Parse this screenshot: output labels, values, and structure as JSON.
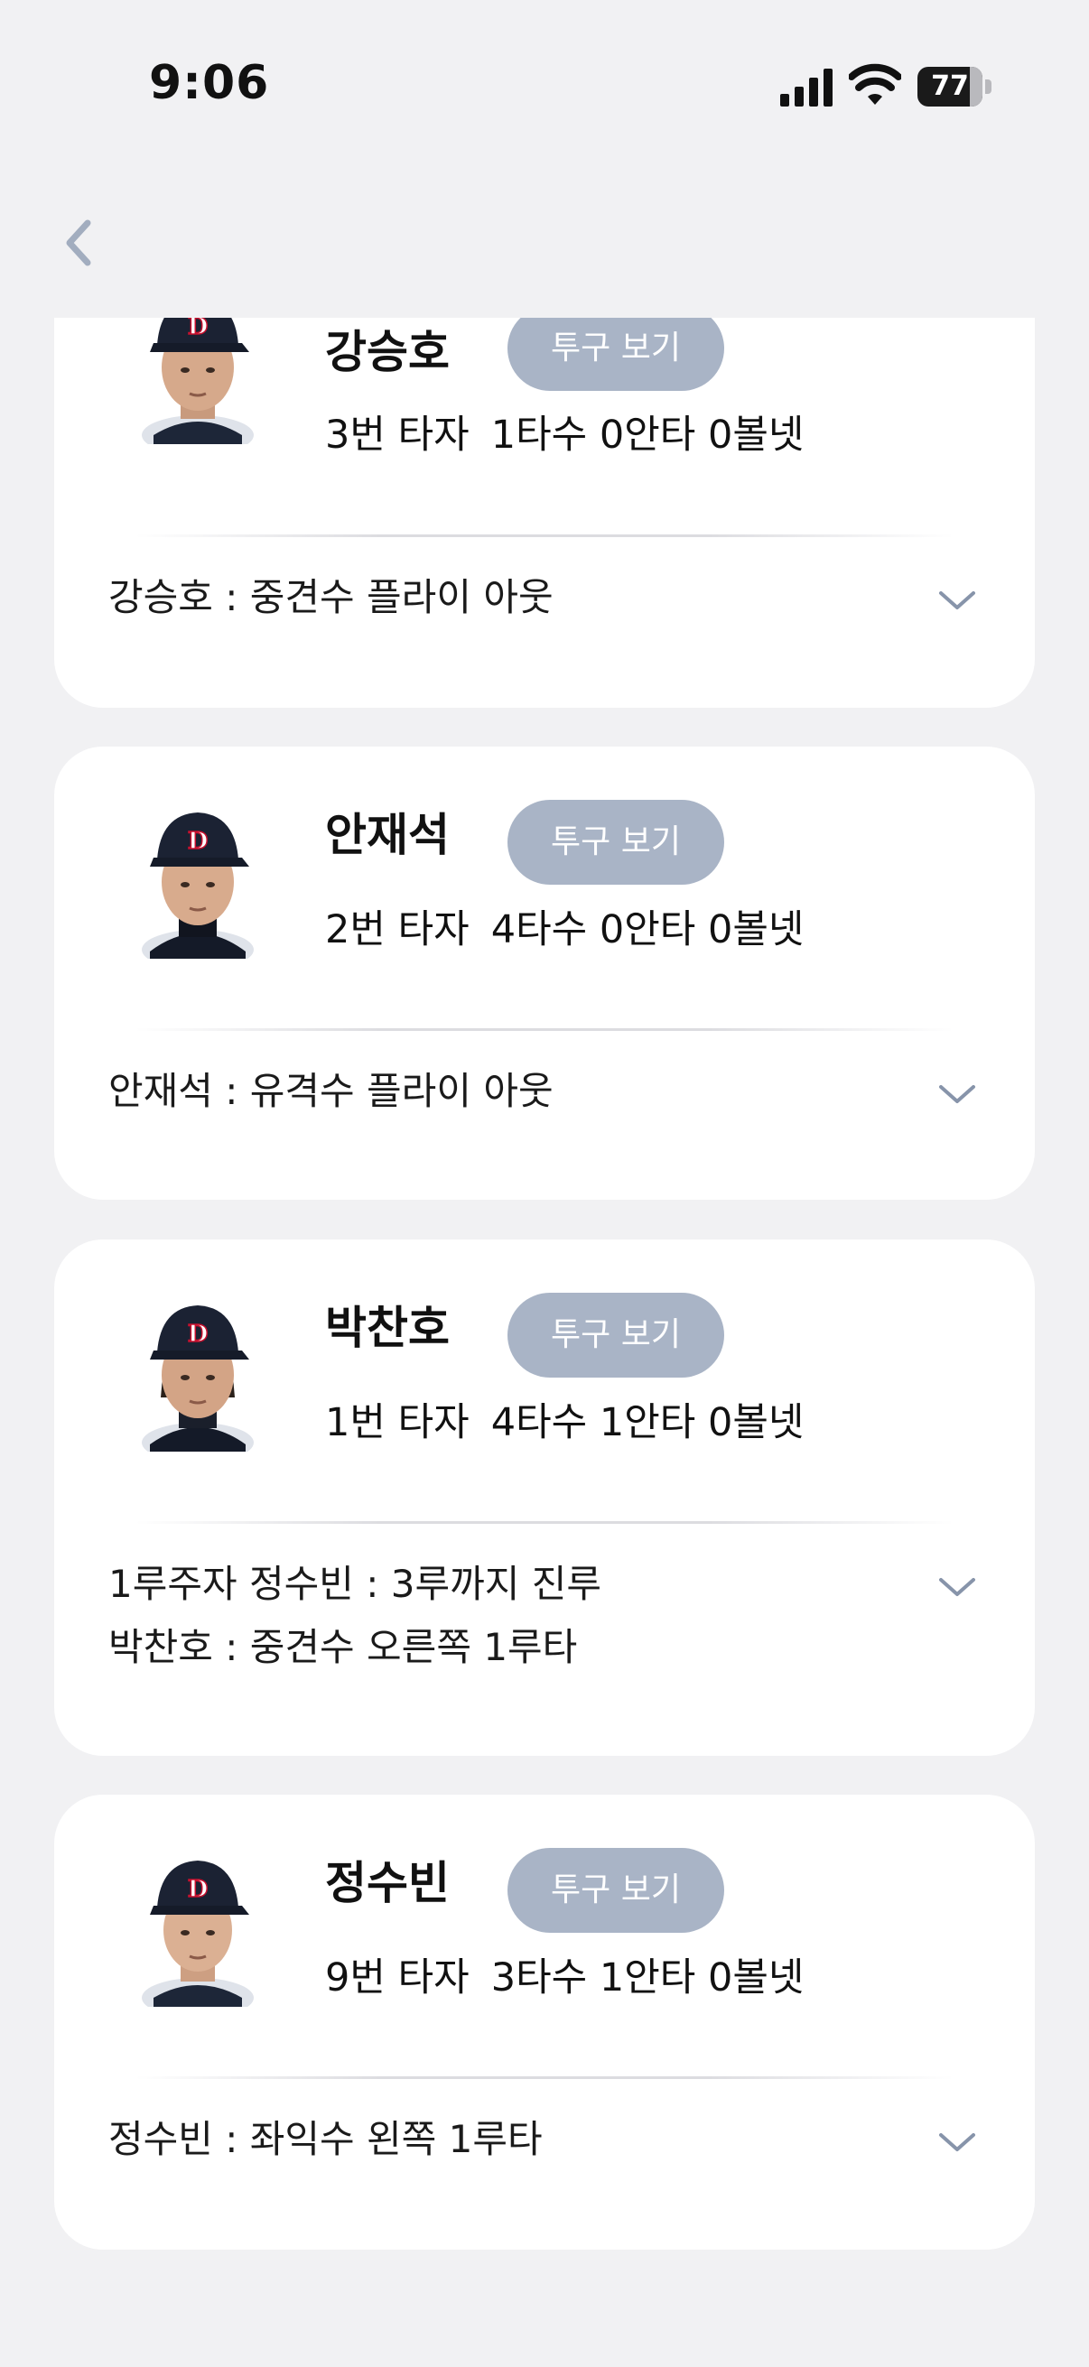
{
  "status_bar": {
    "time": "9:06",
    "battery_level": "77",
    "icons": [
      "signal-icon",
      "wifi-icon",
      "battery-icon"
    ]
  },
  "nav": {
    "back_icon": "chevron-left-icon"
  },
  "colors": {
    "background": "#f1f1f3",
    "card": "#ffffff",
    "pitch_button": "#a9b4c6",
    "back_chevron": "#a2adbf",
    "expand_chevron": "#8794aa"
  },
  "at_bats": [
    {
      "name": "강승호",
      "button_label": "투구 보기",
      "order": "3번 타자",
      "stats": "1타수 0안타 0볼넷",
      "results": [
        "강승호 : 중견수 플라이 아웃"
      ]
    },
    {
      "name": "안재석",
      "button_label": "투구 보기",
      "order": "2번 타자",
      "stats": "4타수 0안타 0볼넷",
      "results": [
        "안재석 : 유격수 플라이 아웃"
      ]
    },
    {
      "name": "박찬호",
      "button_label": "투구 보기",
      "order": "1번 타자",
      "stats": "4타수 1안타 0볼넷",
      "results": [
        "1루주자 정수빈 : 3루까지 진루",
        "박찬호 : 중견수 오른쪽 1루타"
      ]
    },
    {
      "name": "정수빈",
      "button_label": "투구 보기",
      "order": "9번 타자",
      "stats": "3타수 1안타 0볼넷",
      "results": [
        "정수빈 : 좌익수 왼쪽 1루타"
      ]
    }
  ]
}
